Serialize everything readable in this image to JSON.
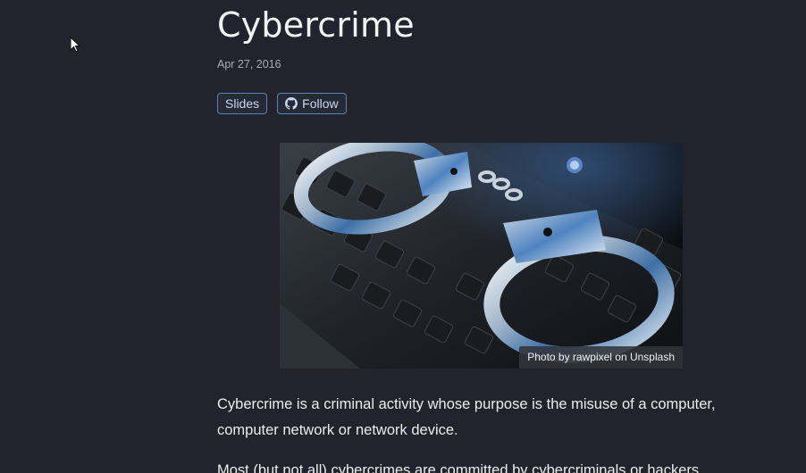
{
  "post": {
    "title": "Cybercrime",
    "date": "Apr 27, 2016",
    "buttons": {
      "slides_label": "Slides",
      "follow_label": "Follow",
      "follow_icon": "github-icon"
    },
    "image": {
      "credit": "Photo by rawpixel on Unsplash",
      "subject": "handcuffs-on-keyboard"
    },
    "paragraphs": [
      "Cybercrime is a criminal activity whose purpose is the misuse of a computer, computer network or network device.",
      "Most (but not all) cybercrimes are committed by cybercriminals or hackers"
    ]
  },
  "colors": {
    "background": "#22232c",
    "button_border": "#5b84b4",
    "button_text": "#c9d8ee"
  },
  "cursor": {
    "icon": "mouse-pointer-icon"
  }
}
